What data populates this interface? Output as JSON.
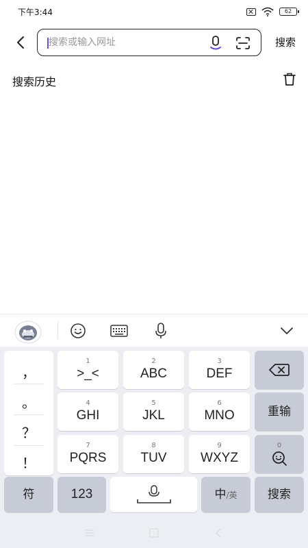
{
  "status_bar": {
    "time": "下午3:44",
    "battery": "62"
  },
  "header": {
    "search_placeholder": "搜索或输入网址",
    "search_value": "",
    "search_button": "搜索"
  },
  "history": {
    "title": "搜索历史"
  },
  "keyboard": {
    "punctuation": [
      "，",
      "。",
      "？",
      "！"
    ],
    "rows": [
      [
        {
          "num": "1",
          "label": ">_<"
        },
        {
          "num": "2",
          "label": "ABC"
        },
        {
          "num": "3",
          "label": "DEF"
        }
      ],
      [
        {
          "num": "4",
          "label": "GHI"
        },
        {
          "num": "5",
          "label": "JKL"
        },
        {
          "num": "6",
          "label": "MNO"
        }
      ],
      [
        {
          "num": "7",
          "label": "PQRS"
        },
        {
          "num": "8",
          "label": "TUV"
        },
        {
          "num": "9",
          "label": "WXYZ"
        }
      ]
    ],
    "retype": "重输",
    "search_key_num": "0",
    "symbols": "符",
    "numbers": "123",
    "lang_main": "中",
    "lang_alt": "/英",
    "search_key": "搜索"
  },
  "colors": {
    "accent": "#6b4ce0",
    "key_gray": "#c7cbd6",
    "keyboard_bg": "#eceef3"
  }
}
